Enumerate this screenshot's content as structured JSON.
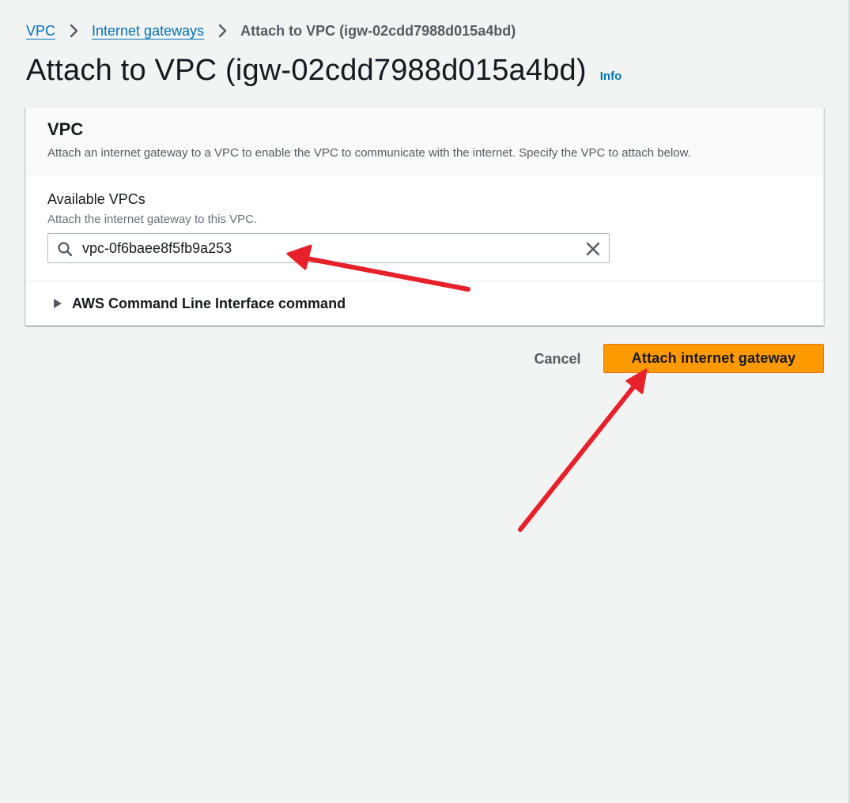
{
  "breadcrumb": {
    "items": [
      "VPC",
      "Internet gateways"
    ],
    "current": "Attach to VPC (igw-02cdd7988d015a4bd)"
  },
  "header": {
    "title": "Attach to VPC (igw-02cdd7988d015a4bd)",
    "info_link": "Info"
  },
  "vpc_panel": {
    "title": "VPC",
    "description": "Attach an internet gateway to a VPC to enable the VPC to communicate with the internet. Specify the VPC to attach below.",
    "field_label": "Available VPCs",
    "field_description": "Attach the internet gateway to this VPC.",
    "search_value": "vpc-0f6baee8f5fb9a253",
    "cli_toggle_label": "AWS Command Line Interface command"
  },
  "actions": {
    "cancel_label": "Cancel",
    "primary_label": "Attach internet gateway"
  },
  "colors": {
    "link": "#0073bb",
    "primary_button": "#ff9900",
    "annotation_arrow": "#e8202a",
    "page_background": "#f2f3f3"
  },
  "icons": {
    "breadcrumb_separator": "chevron-right-icon",
    "search": "search-icon",
    "clear": "close-icon",
    "expand": "caret-right-icon"
  }
}
